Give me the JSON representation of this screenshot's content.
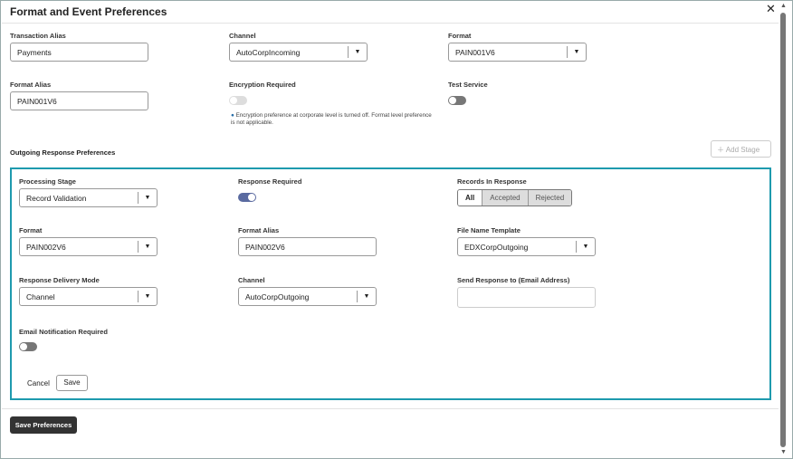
{
  "title": "Format and Event Preferences",
  "fields": {
    "transaction_alias_label": "Transaction Alias",
    "transaction_alias": "Payments",
    "channel_label": "Channel",
    "channel": "AutoCorpIncoming",
    "format_label": "Format",
    "format": "PAIN001V6",
    "format_alias_label": "Format Alias",
    "format_alias": "PAIN001V6",
    "encryption_label": "Encryption Required",
    "encryption_note": "Encryption preference at corporate level is turned off. Format level preference is not applicable.",
    "test_service_label": "Test Service"
  },
  "outgoing": {
    "section_title": "Outgoing Response Preferences",
    "add_stage": "Add Stage",
    "processing_stage_label": "Processing Stage",
    "processing_stage": "Record Validation",
    "response_required_label": "Response Required",
    "records_label": "Records In Response",
    "records_options": [
      "All",
      "Accepted",
      "Rejected"
    ],
    "format_label": "Format",
    "format": "PAIN002V6",
    "format_alias_label": "Format Alias",
    "format_alias": "PAIN002V6",
    "file_template_label": "File Name Template",
    "file_template": "EDXCorpOutgoing",
    "delivery_mode_label": "Response Delivery Mode",
    "delivery_mode": "Channel",
    "channel_label": "Channel",
    "channel": "AutoCorpOutgoing",
    "send_to_label": "Send Response to (Email Address)",
    "send_to": "",
    "email_notif_label": "Email Notification Required",
    "cancel": "Cancel",
    "save": "Save"
  },
  "save_preferences": "Save Preferences"
}
